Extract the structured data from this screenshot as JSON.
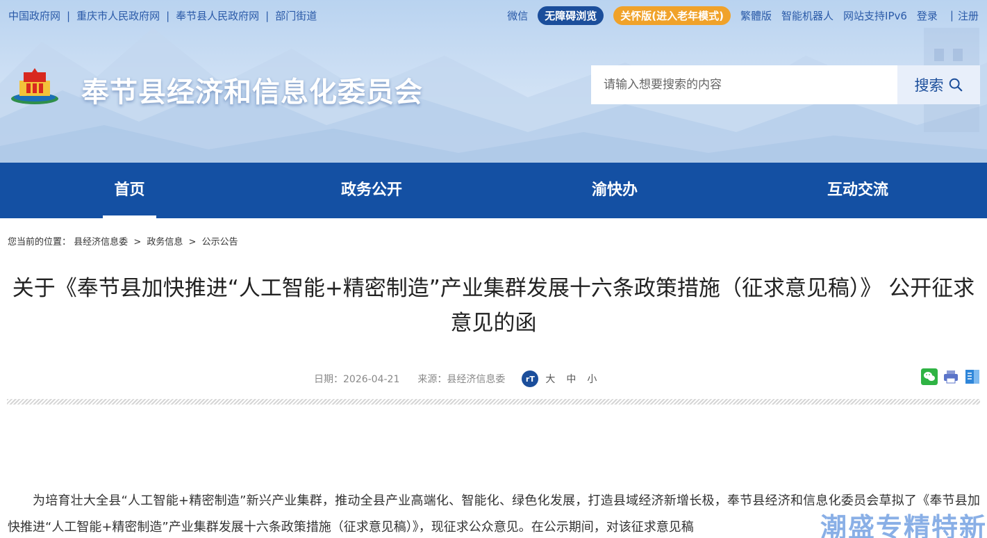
{
  "topbar": {
    "links": [
      "中国政府网",
      "重庆市人民政府网",
      "奉节县人民政府网",
      "部门街道"
    ],
    "separator": "|",
    "wechat": "微信",
    "accessibility": "无障碍浏览",
    "elder_mode": "关怀版(进入老年模式)",
    "traditional": "繁體版",
    "robot": "智能机器人",
    "ipv6": "网站支持IPv6",
    "login": "登录",
    "register": "注册",
    "bar": "|"
  },
  "header": {
    "site_title": "奉节县经济和信息化委员会",
    "search_placeholder": "请输入想要搜索的内容",
    "search_button": "搜索"
  },
  "nav": {
    "items": [
      "首页",
      "政务公开",
      "渝快办",
      "互动交流"
    ],
    "active": "首页"
  },
  "breadcrumb": {
    "prefix": "您当前的位置：",
    "items": [
      "县经济信息委",
      "政务信息",
      "公示公告"
    ],
    "arrow": ">"
  },
  "article": {
    "title": "关于《奉节县加快推进“人工智能+精密制造”产业集群发展十六条政策措施（征求意见稿）》 公开征求意见的函",
    "date_label": "日期：2026-04-21",
    "source_label": "来源：县经济信息委",
    "font_icon_text": "rT",
    "size_large": "大",
    "size_medium": "中",
    "size_small": "小",
    "body": "为培育壮大全县“人工智能+精密制造”新兴产业集群，推动全县产业高端化、智能化、绿色化发展，打造县域经济新增长极，奉节县经济和信息化委员会草拟了《奉节县加快推进“人工智能+精密制造”产业集群发展十六条政策措施（征求意见稿）》，现征求公众意见。在公示期间，对该征求意见稿"
  },
  "watermark": "潮盛专精特新",
  "colors": {
    "nav_blue": "#1450a3",
    "pill_blue": "#1b4e9b",
    "pill_orange": "#f0a22a",
    "link_blue": "#2a5aa8"
  }
}
